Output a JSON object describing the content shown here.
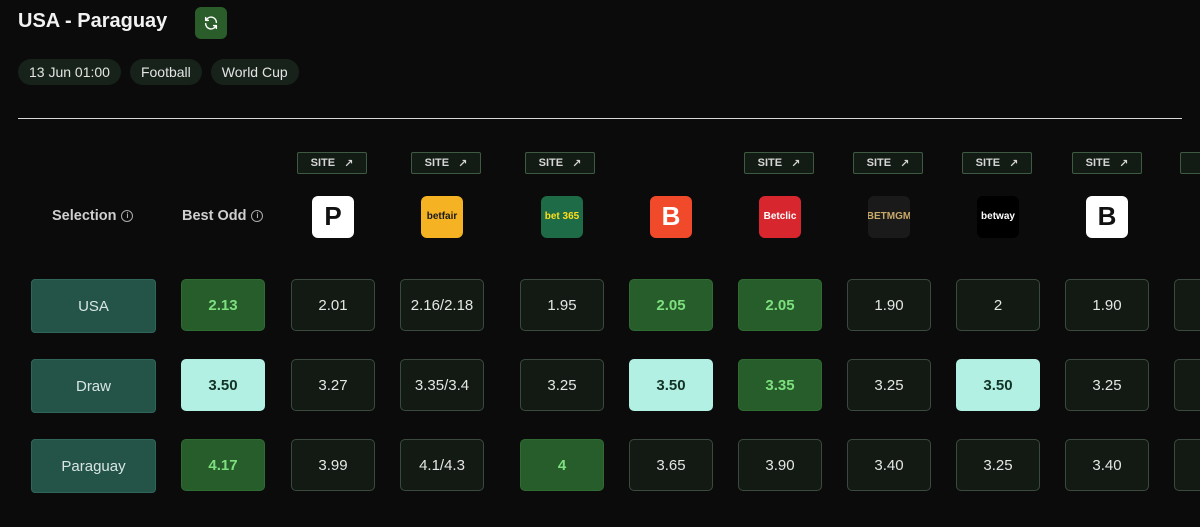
{
  "match": {
    "title": "USA - Paraguay"
  },
  "chips": [
    "13 Jun 01:00",
    "Football",
    "World Cup"
  ],
  "header": {
    "selection": "Selection",
    "best_odd": "Best Odd"
  },
  "site_label": "SITE",
  "bookmakers": [
    {
      "name": "Pinnacle",
      "text": "P",
      "bg": "#ffffff",
      "fg": "#111111",
      "has_site": true
    },
    {
      "name": "Betfair Exchange",
      "text": "betfair",
      "bg": "#f5b324",
      "fg": "#1a1a1a",
      "has_site": true
    },
    {
      "name": "bet365",
      "text": "bet 365",
      "bg": "#1e6b47",
      "fg": "#ffdf1b",
      "has_site": true
    },
    {
      "name": "Betano",
      "text": "B",
      "bg": "#f04a2a",
      "fg": "#ffffff",
      "has_site": false
    },
    {
      "name": "Betclic",
      "text": "Betclic",
      "bg": "#d7262e",
      "fg": "#ffffff",
      "has_site": true
    },
    {
      "name": "BetMGM",
      "text": "BETMGM",
      "bg": "#1a1a1a",
      "fg": "#c9a96a",
      "has_site": true
    },
    {
      "name": "betway",
      "text": "betway",
      "bg": "#000000",
      "fg": "#ffffff",
      "has_site": true
    },
    {
      "name": "Borgata",
      "text": "B",
      "bg": "#ffffff",
      "fg": "#111111",
      "has_site": true
    }
  ],
  "rows": [
    {
      "selection": "USA",
      "best": "2.13",
      "best_style": "green",
      "odds": [
        {
          "v": "2.01"
        },
        {
          "v": "2.16/2.18"
        },
        {
          "v": "1.95"
        },
        {
          "v": "2.05",
          "s": "green"
        },
        {
          "v": "2.05",
          "s": "green"
        },
        {
          "v": "1.90"
        },
        {
          "v": "2"
        },
        {
          "v": "1.90"
        }
      ]
    },
    {
      "selection": "Draw",
      "best": "3.50",
      "best_style": "mint",
      "odds": [
        {
          "v": "3.27"
        },
        {
          "v": "3.35/3.4"
        },
        {
          "v": "3.25"
        },
        {
          "v": "3.50",
          "s": "mint"
        },
        {
          "v": "3.35",
          "s": "green"
        },
        {
          "v": "3.25"
        },
        {
          "v": "3.50",
          "s": "mint"
        },
        {
          "v": "3.25"
        }
      ]
    },
    {
      "selection": "Paraguay",
      "best": "4.17",
      "best_style": "green",
      "odds": [
        {
          "v": "3.99"
        },
        {
          "v": "4.1/4.3"
        },
        {
          "v": "4",
          "s": "green"
        },
        {
          "v": "3.65"
        },
        {
          "v": "3.90"
        },
        {
          "v": "3.40"
        },
        {
          "v": "3.25"
        },
        {
          "v": "3.40"
        }
      ]
    }
  ],
  "colors": {
    "green_bg": "#275c2b",
    "green_text": "#7de07f",
    "mint_bg": "#b2f0e3",
    "selection_bg": "#245348"
  }
}
